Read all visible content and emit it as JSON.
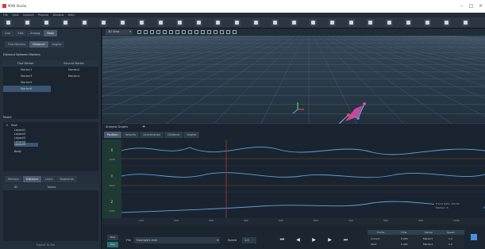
{
  "window": {
    "title": "MVN Studio",
    "controls": [
      "–",
      "□",
      "×"
    ]
  },
  "menu": [
    "File",
    "View",
    "Capture",
    "Process",
    "Window",
    "Help"
  ],
  "toolbar": {
    "icons": [
      "new-icon",
      "open-icon",
      "save-icon",
      "import-icon",
      "export-icon",
      "cut-icon",
      "copy-icon",
      "paste-icon",
      "undo-icon",
      "redo-icon",
      "select-icon",
      "move-icon",
      "rotate-icon",
      "scale-icon",
      "marker-icon",
      "segment-icon",
      "link-icon",
      "unlink-icon",
      "measure-icon",
      "angle-icon",
      "grid-icon",
      "camera-icon",
      "record-icon",
      "settings-icon",
      "help-icon"
    ]
  },
  "left_panel": {
    "tabs": [
      "Calc",
      "Edit",
      "Analog",
      "Body"
    ],
    "sub_tabs": [
      "Find Markers",
      "Distance",
      "Angles"
    ],
    "section_label": "Distance Between Markers",
    "columns": [
      "First Marker",
      "Second Marker"
    ],
    "rows": [
      {
        "first": "Marker1",
        "second": "Marker2"
      },
      {
        "first": "Marker3",
        "second": "Marker4"
      },
      {
        "first": "Marker5",
        "second": ""
      },
      {
        "first": "Marker6",
        "second": ""
      }
    ],
    "mid_label": "Model",
    "tree": {
      "root": "Root",
      "children": [
        "Layout1",
        "Layout2",
        "Layout3",
        "Layout4",
        "Layout5"
      ],
      "extra": "Body"
    },
    "lower_tabs": [
      "Markers",
      "Distance",
      "Links",
      "Segments"
    ],
    "lower_columns": [
      "ID",
      "Name"
    ],
    "footer_label": "Export To File"
  },
  "viewport": {
    "camera_dropdown": "3D View"
  },
  "graphs": {
    "title": "Analysis Graphs",
    "tabs": [
      "Position",
      "Velocity",
      "Acceleration",
      "Distance",
      "Angles"
    ],
    "active_tab": "Position",
    "lanes": [
      {
        "label": "X",
        "value": "1000"
      },
      {
        "label": "Y",
        "value": "1000"
      },
      {
        "label": "Z",
        "value": "1000"
      }
    ],
    "info_lines": [
      "Frame Rate: 100 Hz",
      "Markers: 6"
    ],
    "timeline_ticks": [
      "100",
      "200",
      "300",
      "400",
      "500",
      "600",
      "700",
      "800",
      "900",
      "1000"
    ]
  },
  "bottom": {
    "left_buttons": [
      "Stop",
      "Play"
    ],
    "file_label": "File",
    "file_value": "Example1.mvn",
    "speed_label": "Speed",
    "speed_value": "1.0",
    "table_headers": [
      "Frame",
      "Time",
      "Marker",
      "Speed"
    ],
    "table_rows": [
      [
        "Current",
        "0.000",
        "Marker1",
        "1.0"
      ],
      [
        "Start",
        "0.000",
        "Marker2",
        "1.0"
      ]
    ]
  },
  "colors": {
    "accent": "#d64aa7",
    "axis_x": "#e04b4b",
    "axis_y": "#4ed26c",
    "axis_z": "#4b8ee0",
    "series": "#5aa3d9",
    "cursor": "#b03232"
  }
}
